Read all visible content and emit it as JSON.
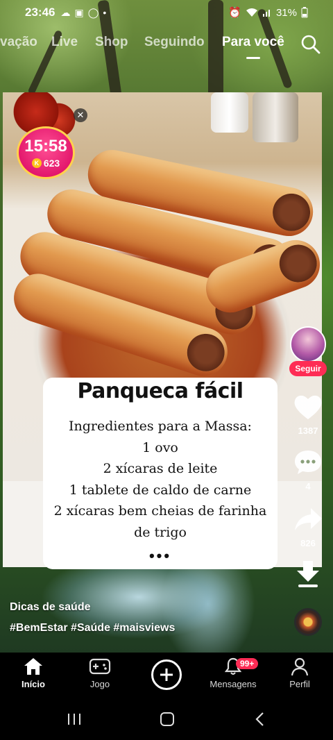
{
  "status_bar": {
    "time": "23:46",
    "battery": "31%"
  },
  "top_nav": {
    "tabs": [
      {
        "label": "vação",
        "active": false
      },
      {
        "label": "Live",
        "active": false
      },
      {
        "label": "Shop",
        "active": false
      },
      {
        "label": "Seguindo",
        "active": false
      },
      {
        "label": "Para você",
        "active": true
      }
    ]
  },
  "timer": {
    "time": "15:58",
    "coins": "623"
  },
  "recipe": {
    "title": "Panqueca fácil",
    "heading": "Ingredientes para a Massa:",
    "lines": [
      "1 ovo",
      "2 xícaras de leite",
      "1 tablete de caldo de carne",
      "2 xícaras bem cheias de farinha",
      "de trigo"
    ],
    "more": "•••"
  },
  "rail": {
    "follow_label": "Seguir",
    "likes": "1387",
    "comments": "4",
    "shares": "826"
  },
  "caption": {
    "user": "Dicas de saúde",
    "hashtags": "#BemEstar #Saúde #maisviews"
  },
  "bottom_nav": {
    "items": [
      {
        "label": "Início",
        "icon": "home-icon",
        "active": true
      },
      {
        "label": "Jogo",
        "icon": "gamepad-icon",
        "active": false
      },
      {
        "label": "Mensagens",
        "icon": "bell-icon",
        "active": false,
        "badge": "99+"
      },
      {
        "label": "Perfil",
        "icon": "person-icon",
        "active": false
      }
    ]
  },
  "colors": {
    "accent": "#fe2c55",
    "timer": "#e3186d"
  }
}
